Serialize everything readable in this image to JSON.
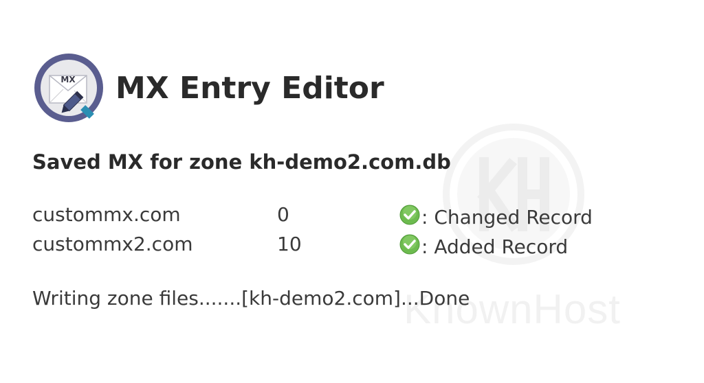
{
  "header": {
    "title": "MX Entry Editor",
    "icon_label": "MX"
  },
  "result": {
    "heading": "Saved MX for zone kh-demo2.com.db",
    "records": [
      {
        "host": "custommx.com",
        "priority": "0",
        "status": ": Changed Record"
      },
      {
        "host": "custommx2.com",
        "priority": "10",
        "status": ": Added Record"
      }
    ],
    "writing": "Writing zone files.......[kh-demo2.com]...Done"
  },
  "watermark": {
    "text": "KnownHost"
  },
  "colors": {
    "icon_circle": "#5a5d8f",
    "check_green": "#6dbb4f",
    "text": "#2a2a2a",
    "watermark": "#f1f1f1"
  },
  "icons": {
    "app": "mx-envelope-pencil-icon",
    "status": "check-circle-icon"
  }
}
